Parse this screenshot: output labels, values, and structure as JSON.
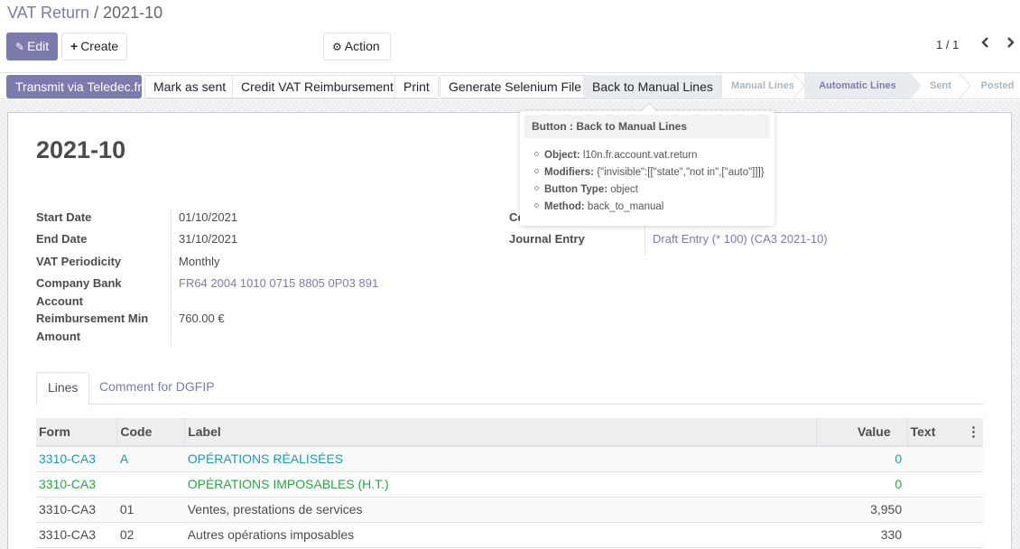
{
  "breadcrumb": {
    "parent": "VAT Return",
    "separator": "/",
    "current": "2021-10"
  },
  "toolbar": {
    "edit_label": "Edit",
    "create_label": "Create",
    "action_label": "Action",
    "icons": {
      "edit": "pencil-icon",
      "create": "plus-icon",
      "action": "gear-icon"
    }
  },
  "pager": {
    "value": "1 / 1",
    "prev": "‹",
    "next": "›"
  },
  "statusbar": {
    "buttons": [
      {
        "label": "Transmit via Teledec.fr",
        "style": "primary"
      },
      {
        "label": "Mark as sent",
        "style": "default"
      },
      {
        "label": "Credit VAT Reimbursement",
        "style": "default"
      },
      {
        "label": "Print",
        "style": "default"
      },
      {
        "label": "Generate Selenium File",
        "style": "default"
      },
      {
        "label": "Back to Manual Lines",
        "style": "hover"
      }
    ],
    "stages": [
      {
        "label": "Manual Lines",
        "current": false
      },
      {
        "label": "Automatic Lines",
        "current": true
      },
      {
        "label": "Sent",
        "current": false
      },
      {
        "label": "Posted",
        "current": false
      }
    ]
  },
  "record": {
    "title": "2021-10",
    "fields_left": [
      {
        "label": "Start Date",
        "value": "01/10/2021",
        "link": false
      },
      {
        "label": "End Date",
        "value": "31/10/2021",
        "link": false
      },
      {
        "label": "VAT Periodicity",
        "value": "Monthly",
        "link": false
      },
      {
        "label_line1": "Company Bank",
        "label_line2": "Account",
        "value": "FR64 2004 1010 0715 8805 0P03 891",
        "link": true
      },
      {
        "label_line1": "Reimbursement Min",
        "label_line2": "Amount",
        "value": "760.00 €",
        "link": false
      }
    ],
    "fields_right": [
      {
        "label": "Co",
        "value": "",
        "link": false
      },
      {
        "label": "Journal Entry",
        "value": "Draft Entry (* 100) (CA3 2021-10)",
        "link": true
      }
    ]
  },
  "tabs": [
    {
      "label": "Lines",
      "active": true
    },
    {
      "label": "Comment for DGFIP",
      "active": false
    }
  ],
  "lines_table": {
    "columns": [
      "Form",
      "Code",
      "Label",
      "Value",
      "Text"
    ],
    "optional_columns_icon": "vertical-dots-icon",
    "rows": [
      {
        "form": "3310-CA3",
        "code": "A",
        "label": "OPÉRATIONS RÉALISÉES",
        "value": "0",
        "text": "",
        "level": "a"
      },
      {
        "form": "3310-CA3",
        "code": "",
        "label": "OPÉRATIONS IMPOSABLES (H.T.)",
        "value": "0",
        "text": "",
        "level": "b"
      },
      {
        "form": "3310-CA3",
        "code": "01",
        "label": "Ventes, prestations de services",
        "value": "3,950",
        "text": "",
        "level": "c"
      },
      {
        "form": "3310-CA3",
        "code": "02",
        "label": "Autres opérations imposables",
        "value": "330",
        "text": "",
        "level": "c"
      }
    ]
  },
  "tooltip": {
    "title": "Button : Back to Manual Lines",
    "items": [
      {
        "key": "Object:",
        "value": "l10n.fr.account.vat.return"
      },
      {
        "key": "Modifiers:",
        "value": "{\"invisible\":[[\"state\",\"not in\",[\"auto\"]]]}"
      },
      {
        "key": "Button Type:",
        "value": "object"
      },
      {
        "key": "Method:",
        "value": "back_to_manual"
      }
    ]
  },
  "colors": {
    "brand": "#7c7bad",
    "level_a": "#1a9cb3",
    "level_b": "#28a745",
    "text": "#4c4c4c"
  }
}
